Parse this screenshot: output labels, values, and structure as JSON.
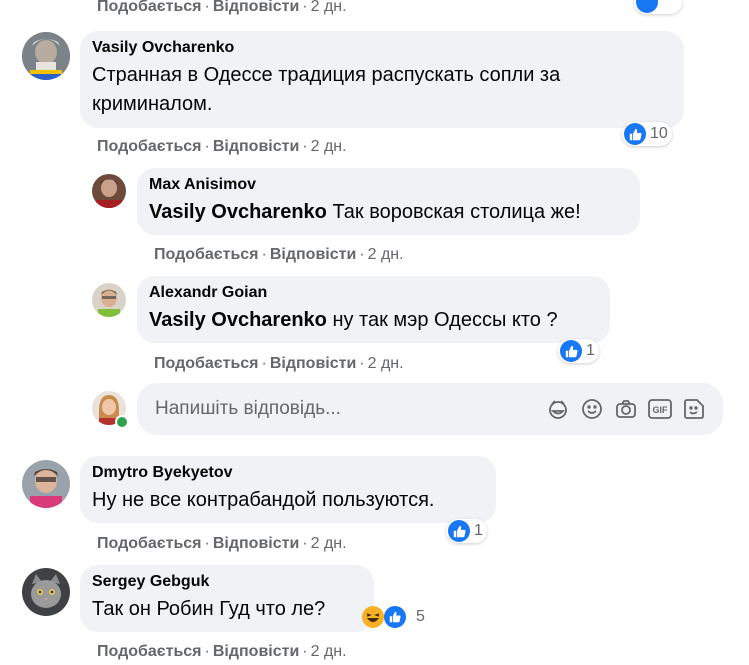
{
  "colors": {
    "bubble": "#f0f2f5",
    "secondary_text": "#65676b",
    "like_blue": "#1877f2",
    "online_green": "#31a24c"
  },
  "top": {
    "actions": {
      "like": "Подобається",
      "reply": "Відповісти",
      "time": "2 дн."
    }
  },
  "comments": [
    {
      "author": "Vasily Ovcharenko",
      "text": "Странная в Одессе традиция распускать сопли за криминалом.",
      "reaction_count": "10",
      "actions": {
        "like": "Подобається",
        "reply": "Відповісти",
        "time": "2 дн."
      },
      "replies": [
        {
          "author": "Max Anisimov",
          "mention": "Vasily Ovcharenko",
          "text": "Так воровская столица же!",
          "actions": {
            "like": "Подобається",
            "reply": "Відповісти",
            "time": "2 дн."
          }
        },
        {
          "author": "Alexandr Goian",
          "mention": "Vasily Ovcharenko",
          "text": "ну так мэр Одессы кто ?",
          "reaction_count": "1",
          "actions": {
            "like": "Подобається",
            "reply": "Відповісти",
            "time": "2 дн."
          }
        }
      ],
      "reply_input": {
        "placeholder": "Напишіть відповідь..."
      }
    },
    {
      "author": "Dmytro Byekyetov",
      "text": "Ну не все контрабандой пользуются.",
      "reaction_count": "1",
      "actions": {
        "like": "Подобається",
        "reply": "Відповісти",
        "time": "2 дн."
      }
    },
    {
      "author": "Sergey Gebguk",
      "text": "Так он Робин Гуд что ле?",
      "reaction_count": "5",
      "actions": {
        "like": "Подобається",
        "reply": "Відповісти",
        "time": "2 дн."
      }
    }
  ],
  "icons": [
    "like-icon",
    "haha-icon",
    "sticker-icon",
    "emoji-icon",
    "camera-icon",
    "gif-icon",
    "avatar-sticker-icon"
  ]
}
